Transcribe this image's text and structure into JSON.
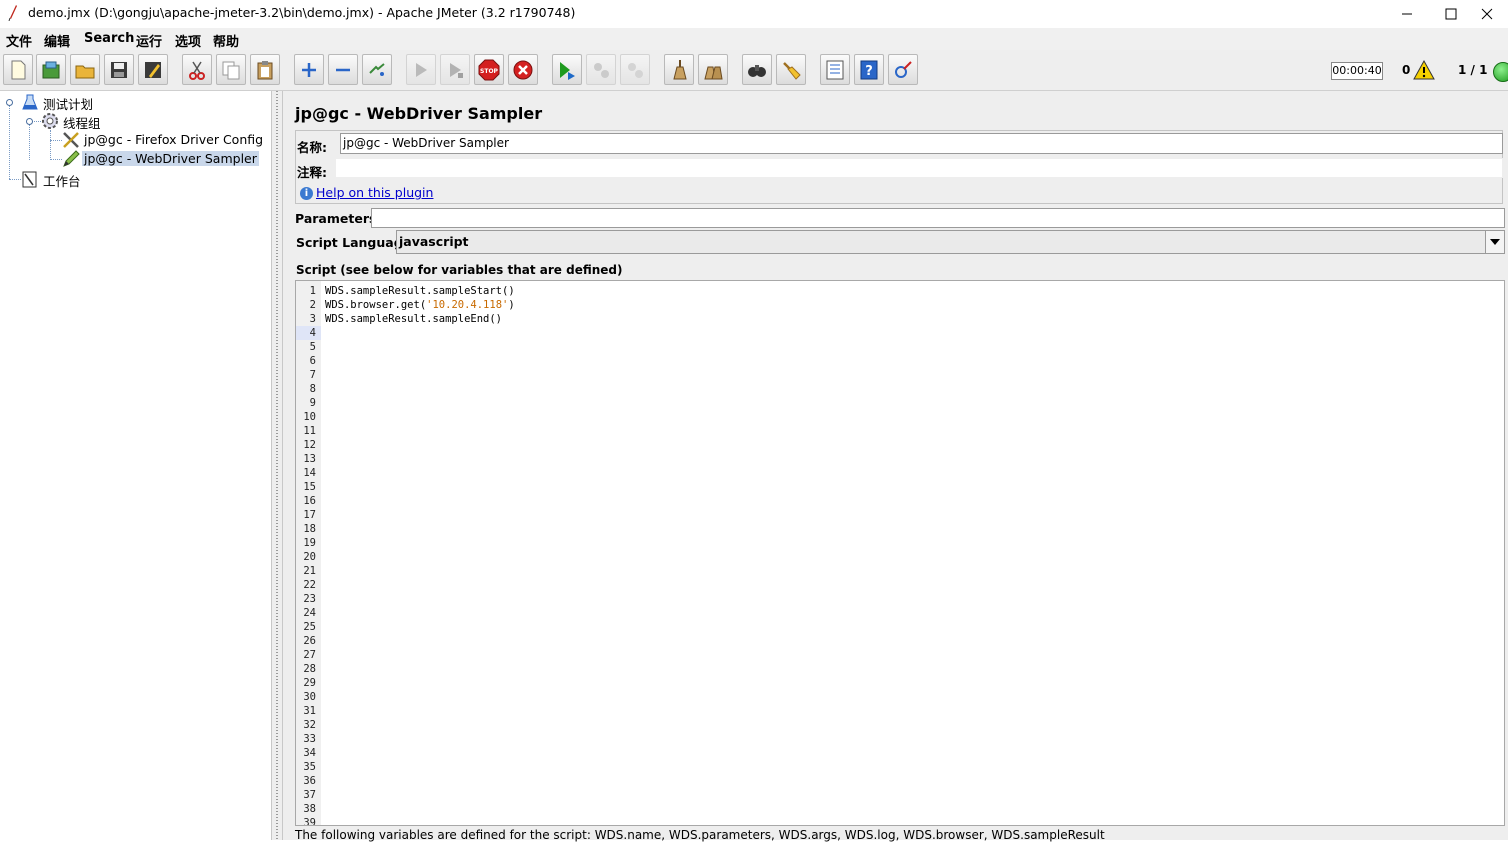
{
  "window": {
    "title": "demo.jmx (D:\\gongju\\apache-jmeter-3.2\\bin\\demo.jmx) - Apache JMeter (3.2 r1790748)",
    "controls": [
      "minimize-icon",
      "maximize-icon",
      "close-icon"
    ]
  },
  "menu": [
    "文件",
    "编辑",
    "Search",
    "运行",
    "选项",
    "帮助"
  ],
  "toolbar": {
    "buttons": [
      "new-icon",
      "templates-icon",
      "open-icon",
      "save-icon",
      "save-as-icon",
      "cut-icon",
      "copy-icon",
      "paste-icon",
      "expand-icon",
      "collapse-icon",
      "toggle-icon",
      "start-icon",
      "start-no-pause-icon",
      "stop-icon",
      "shutdown-icon",
      "remote-start-icon",
      "remote-stop-icon",
      "remote-shutdown-icon",
      "clear-icon",
      "clear-all-icon",
      "search-icon",
      "reset-search-icon",
      "function-helper-icon",
      "help-icon",
      "log-viewer-icon"
    ],
    "timer": "00:00:40",
    "warning_count": "0",
    "threads": "1 / 1",
    "colors": {
      "stop": "#d42020",
      "start": "#1f9a1f",
      "running": "#2bb32b"
    }
  },
  "tree": {
    "items": [
      {
        "label": "测试计划",
        "icon": "test-plan-icon"
      },
      {
        "label": "线程组",
        "icon": "thread-group-icon"
      },
      {
        "label": "jp@gc - Firefox Driver Config",
        "icon": "config-tools-icon"
      },
      {
        "label": "jp@gc - WebDriver Sampler",
        "icon": "sampler-pencil-icon",
        "selected": true
      },
      {
        "label": "工作台",
        "icon": "workbench-icon"
      }
    ]
  },
  "panel": {
    "title": "jp@gc - WebDriver Sampler",
    "name_label": "名称:",
    "name_value": "jp@gc - WebDriver Sampler",
    "comment_label": "注释:",
    "comment_value": "",
    "help_link": "Help on this plugin",
    "parameters_label": "Parameters:",
    "parameters_value": "",
    "script_language_label": "Script Language:",
    "script_language_value": "javascript",
    "script_section_label": "Script (see below for variables that are defined)",
    "script_lines": [
      "WDS.sampleResult.sampleStart()",
      "WDS.browser.get('10.20.4.118')",
      "WDS.sampleResult.sampleEnd()"
    ],
    "line_count": 39,
    "current_line": 4,
    "footer": "The following variables are defined for the script: WDS.name, WDS.parameters, WDS.args, WDS.log, WDS.browser, WDS.sampleResult"
  }
}
